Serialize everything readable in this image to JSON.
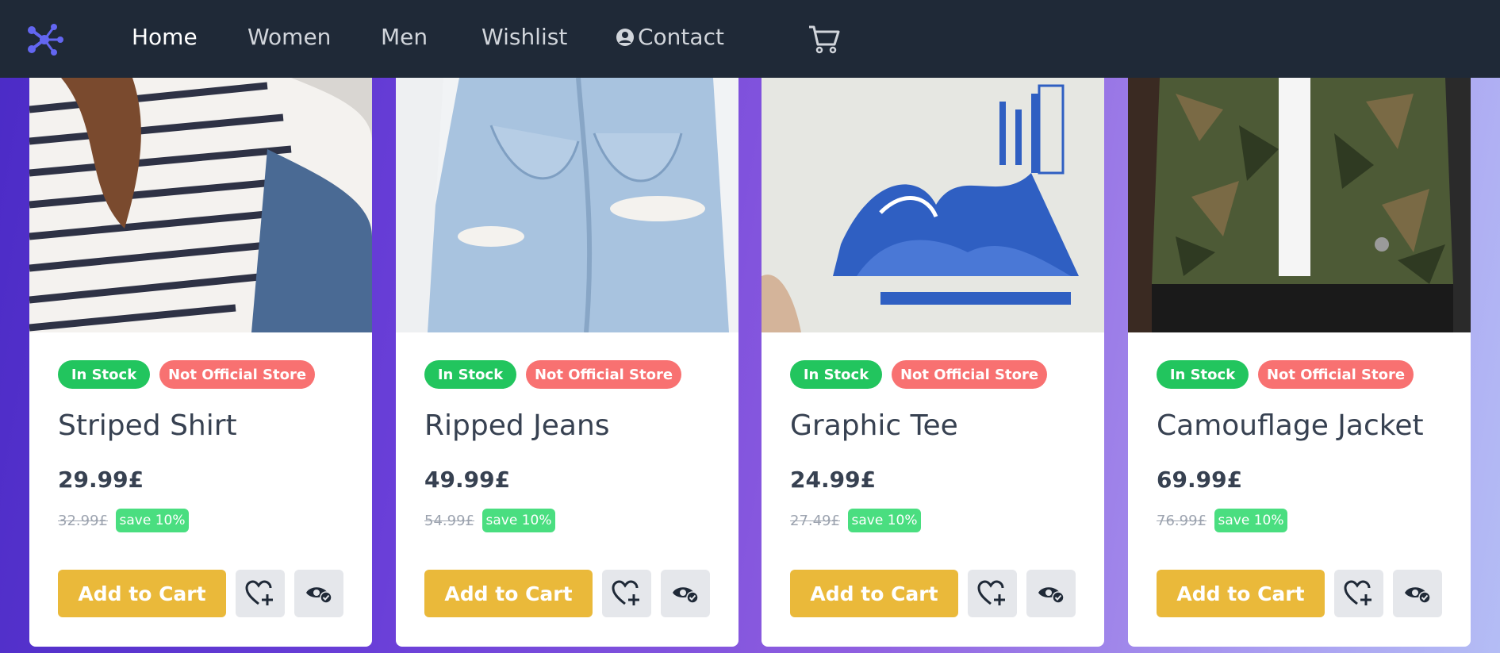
{
  "nav": {
    "links": [
      "Home",
      "Women",
      "Men",
      "Wishlist",
      "Contact"
    ],
    "icons": {
      "logo": "molecule-logo",
      "contact": "user-circle-icon",
      "cart": "cart-icon"
    }
  },
  "colors": {
    "navbar": "#1f2937",
    "in_stock": "#22c55e",
    "not_official": "#f87171",
    "save": "#4ade80",
    "add_to_cart": "#eab93a"
  },
  "products": [
    {
      "title": "Striped Shirt",
      "price": "29.99£",
      "old_price": "32.99£",
      "save": "save 10%",
      "stock_badge": "In Stock",
      "store_badge": "Not Official Store",
      "cta": "Add to Cart"
    },
    {
      "title": "Ripped Jeans",
      "price": "49.99£",
      "old_price": "54.99£",
      "save": "save 10%",
      "stock_badge": "In Stock",
      "store_badge": "Not Official Store",
      "cta": "Add to Cart"
    },
    {
      "title": "Graphic Tee",
      "price": "24.99£",
      "old_price": "27.49£",
      "save": "save 10%",
      "stock_badge": "In Stock",
      "store_badge": "Not Official Store",
      "cta": "Add to Cart"
    },
    {
      "title": "Camouflage Jacket",
      "price": "69.99£",
      "old_price": "76.99£",
      "save": "save 10%",
      "stock_badge": "In Stock",
      "store_badge": "Not Official Store",
      "cta": "Add to Cart"
    }
  ]
}
